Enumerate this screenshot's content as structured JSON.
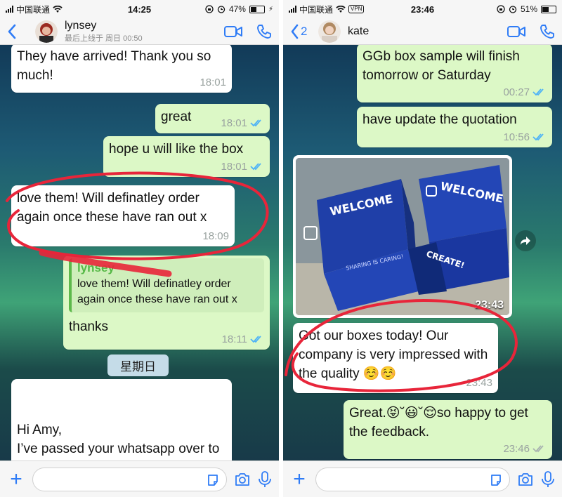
{
  "left": {
    "status": {
      "carrier": "中国联通",
      "time": "14:25",
      "battery": "47%",
      "battery_level": 0.47
    },
    "header": {
      "contact_name": "lynsey",
      "subtitle": "最后上线于 周日 00:50"
    },
    "messages": {
      "m1": {
        "text": "They have arrived! Thank you so much!",
        "time": "18:01"
      },
      "m2": {
        "text": "great",
        "time": "18:01"
      },
      "m3": {
        "text": "hope u will like the box",
        "time": "18:01"
      },
      "m4": {
        "text": "love them! Will definatley order again once these have ran out x",
        "time": "18:09"
      },
      "m5": {
        "quote_name": "lynsey",
        "quote_text": "love them! Will definatley order again once these have ran out x",
        "text": "thanks",
        "time": "18:11"
      },
      "m6": {
        "text": "Hi Amy,\nI’ve passed your whatsapp over to my friend Carol who is looking for boxes made. Hope"
      }
    },
    "date_divider": "星期日"
  },
  "right": {
    "status": {
      "carrier": "中国联通",
      "vpn": "VPN",
      "time": "23:46",
      "battery": "51%",
      "battery_level": 0.51
    },
    "header": {
      "back_count": "2",
      "contact_name": "kate"
    },
    "messages": {
      "m1": {
        "text": "GGb box sample will finish tomorrow or Saturday",
        "time": "00:27"
      },
      "m2": {
        "text": "have update the quotation",
        "time": "10:56"
      },
      "photo": {
        "time": "23:43",
        "lid_text_1": "WELCOME",
        "lid_text_2": "WELCOME",
        "side_text_1": "CREATE!",
        "side_text_2": "SHARING IS CARING!"
      },
      "m4": {
        "text": "Got our boxes today! Our company is very impressed with the quality ☺️☺️",
        "time": "23:43"
      },
      "m5": {
        "text": "Great.😝˘😃˘😌so happy to get the feedback.",
        "time": "23:46"
      }
    }
  },
  "colors": {
    "incoming_bubble": "#ffffff",
    "outgoing_bubble": "#dcf8c6",
    "tick_blue": "#4fb3f6",
    "ios_blue": "#2f7cf6",
    "annotation_red": "#e8253a"
  },
  "icons": [
    "back-chevron-icon",
    "video-call-icon",
    "phone-call-icon",
    "plus-icon",
    "sticker-icon",
    "camera-icon",
    "microphone-icon",
    "forward-icon",
    "double-tick-icon",
    "wifi-icon",
    "alarm-icon",
    "rotation-lock-icon",
    "battery-icon",
    "signal-icon"
  ]
}
